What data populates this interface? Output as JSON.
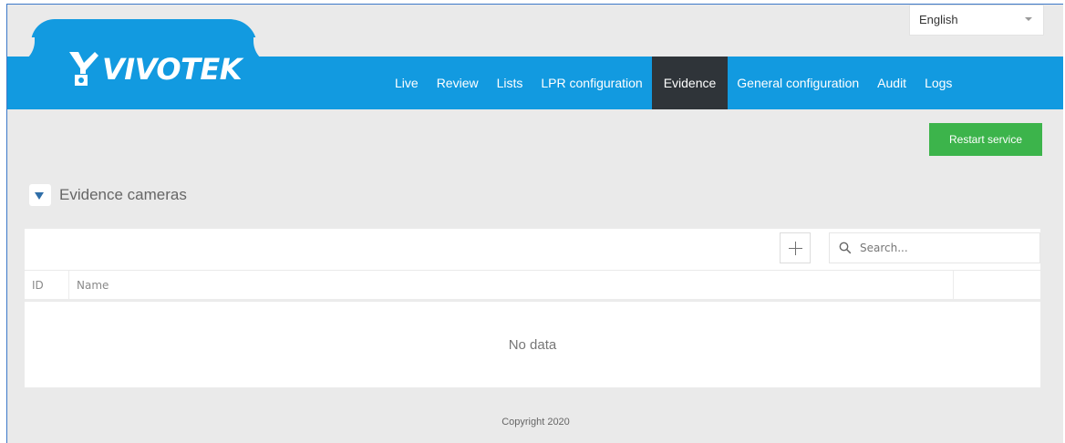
{
  "language_select": {
    "value": "English"
  },
  "brand": {
    "name": "VIVOTEK"
  },
  "nav": {
    "items": [
      {
        "label": "Live"
      },
      {
        "label": "Review"
      },
      {
        "label": "Lists"
      },
      {
        "label": "LPR configuration"
      },
      {
        "label": "Evidence",
        "active": true
      },
      {
        "label": "General configuration"
      },
      {
        "label": "Audit"
      },
      {
        "label": "Logs"
      }
    ]
  },
  "actions": {
    "restart_label": "Restart service"
  },
  "section": {
    "title": "Evidence cameras"
  },
  "table": {
    "search_placeholder": "Search...",
    "columns": [
      "ID",
      "Name",
      ""
    ],
    "empty_text": "No data"
  },
  "footer": {
    "copyright": "Copyright 2020"
  },
  "colors": {
    "navbar": "#129ae0",
    "active_tab": "#2f3439",
    "restart_button": "#3cb44b",
    "background": "#eaeaea"
  }
}
